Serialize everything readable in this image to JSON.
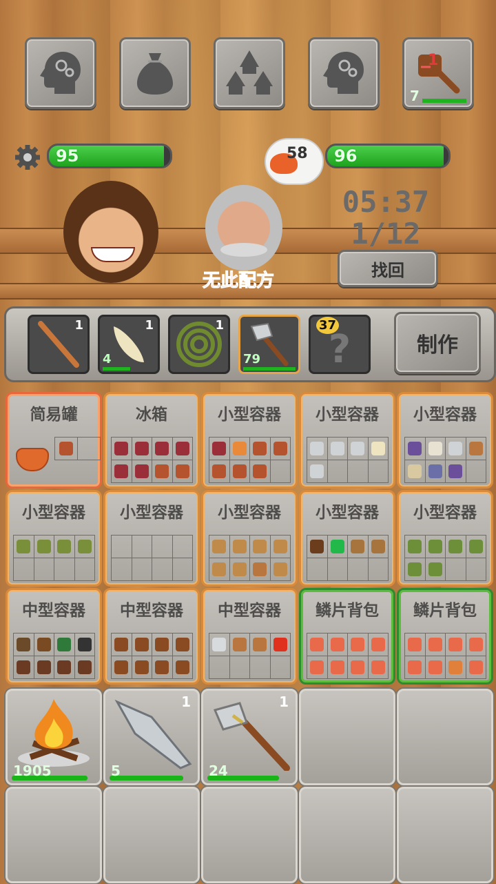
{
  "top_buttons": [
    {
      "icon": "head-gears-icon"
    },
    {
      "icon": "sack-icon"
    },
    {
      "icon": "huts-icon"
    },
    {
      "icon": "head-gears-icon"
    },
    {
      "icon": "paddle-icon",
      "count": "7",
      "badge": "1"
    }
  ],
  "player_bar": {
    "value": "95",
    "fill": 0.95
  },
  "npc_bar": {
    "value": "96",
    "fill": 0.96
  },
  "npc_thought": {
    "value": "58"
  },
  "timer": {
    "time": "05:37",
    "progress": "1/12"
  },
  "find_button": "找回",
  "status_text": "无此配方",
  "craft_slots": [
    {
      "icon": "stick-icon",
      "count": "1",
      "durability": ""
    },
    {
      "icon": "tooth-icon",
      "count": "1",
      "durability": "4"
    },
    {
      "icon": "rope-coil-icon",
      "count": "1",
      "durability": ""
    },
    {
      "icon": "stone-axe-icon",
      "count": "",
      "durability": "79"
    },
    {
      "icon": "question-icon",
      "count": "37",
      "durability": ""
    }
  ],
  "craft_button": "制作",
  "containers": [
    {
      "title": "简易罐",
      "items": [
        "meat",
        "",
        "",
        "",
        "",
        "",
        "",
        ""
      ]
    },
    {
      "title": "冰箱",
      "items": [
        "drumstick",
        "drumstick",
        "drumstick",
        "drumstick",
        "drumstick",
        "drumstick",
        "meat",
        "meat"
      ]
    },
    {
      "title": "小型容器",
      "items": [
        "drumstick",
        "egg",
        "meat",
        "meat",
        "meat",
        "meat",
        "meat",
        ""
      ]
    },
    {
      "title": "小型容器",
      "items": [
        "axe",
        "axe",
        "axe",
        "tooth",
        "axe",
        "",
        "",
        ""
      ]
    },
    {
      "title": "小型容器",
      "items": [
        "feather",
        "bone",
        "axe",
        "stick",
        "scroll",
        "hammer",
        "feather",
        ""
      ]
    },
    {
      "title": "小型容器",
      "items": [
        "rope",
        "rope",
        "rope",
        "rope",
        "",
        "",
        "",
        ""
      ]
    },
    {
      "title": "小型容器",
      "items": [
        "",
        "",
        "",
        "",
        "",
        "",
        "",
        ""
      ]
    },
    {
      "title": "小型容器",
      "items": [
        "log",
        "log",
        "log",
        "log",
        "log",
        "log",
        "stick",
        "log"
      ]
    },
    {
      "title": "小型容器",
      "items": [
        "nut",
        "emerald",
        "dirt",
        "dirt",
        "",
        "",
        "",
        ""
      ]
    },
    {
      "title": "小型容器",
      "items": [
        "block",
        "block",
        "block",
        "block",
        "block",
        "block",
        "",
        ""
      ]
    },
    {
      "title": "中型容器",
      "items": [
        "root",
        "figure",
        "duck",
        "skull",
        "boar",
        "boar",
        "boar",
        "boar"
      ]
    },
    {
      "title": "中型容器",
      "items": [
        "wood",
        "wood",
        "wood",
        "wood",
        "wood",
        "wood",
        "wood",
        "wood"
      ]
    },
    {
      "title": "中型容器",
      "items": [
        "rock",
        "stick",
        "stick",
        "tomato",
        "",
        "",
        "",
        ""
      ]
    },
    {
      "title": "鳞片背包",
      "items": [
        "fish",
        "fish",
        "fish",
        "fish",
        "fish",
        "fish",
        "fish",
        "fish"
      ]
    },
    {
      "title": "鳞片背包",
      "items": [
        "fish",
        "fish",
        "fish",
        "fish",
        "fish",
        "fish",
        "shrimp",
        "fish"
      ]
    }
  ],
  "inventory": [
    {
      "icon": "campfire-icon",
      "count": "",
      "durability": "1905",
      "fill": 0.95
    },
    {
      "icon": "spearhead-icon",
      "count": "1",
      "durability": "5",
      "fill": 0.92
    },
    {
      "icon": "stone-axe-icon",
      "count": "1",
      "durability": "24",
      "fill": 0.9
    },
    {
      "icon": "",
      "count": "",
      "durability": ""
    },
    {
      "icon": "",
      "count": "",
      "durability": ""
    },
    {
      "icon": "",
      "count": "",
      "durability": ""
    },
    {
      "icon": "",
      "count": "",
      "durability": ""
    },
    {
      "icon": "",
      "count": "",
      "durability": ""
    },
    {
      "icon": "",
      "count": "",
      "durability": ""
    },
    {
      "icon": "",
      "count": "",
      "durability": ""
    }
  ],
  "colors": {
    "health": "#22b022",
    "status_red": "#e23a3a",
    "container_border": "#d98a3a",
    "scale_bag_border": "#2e8a2e"
  }
}
